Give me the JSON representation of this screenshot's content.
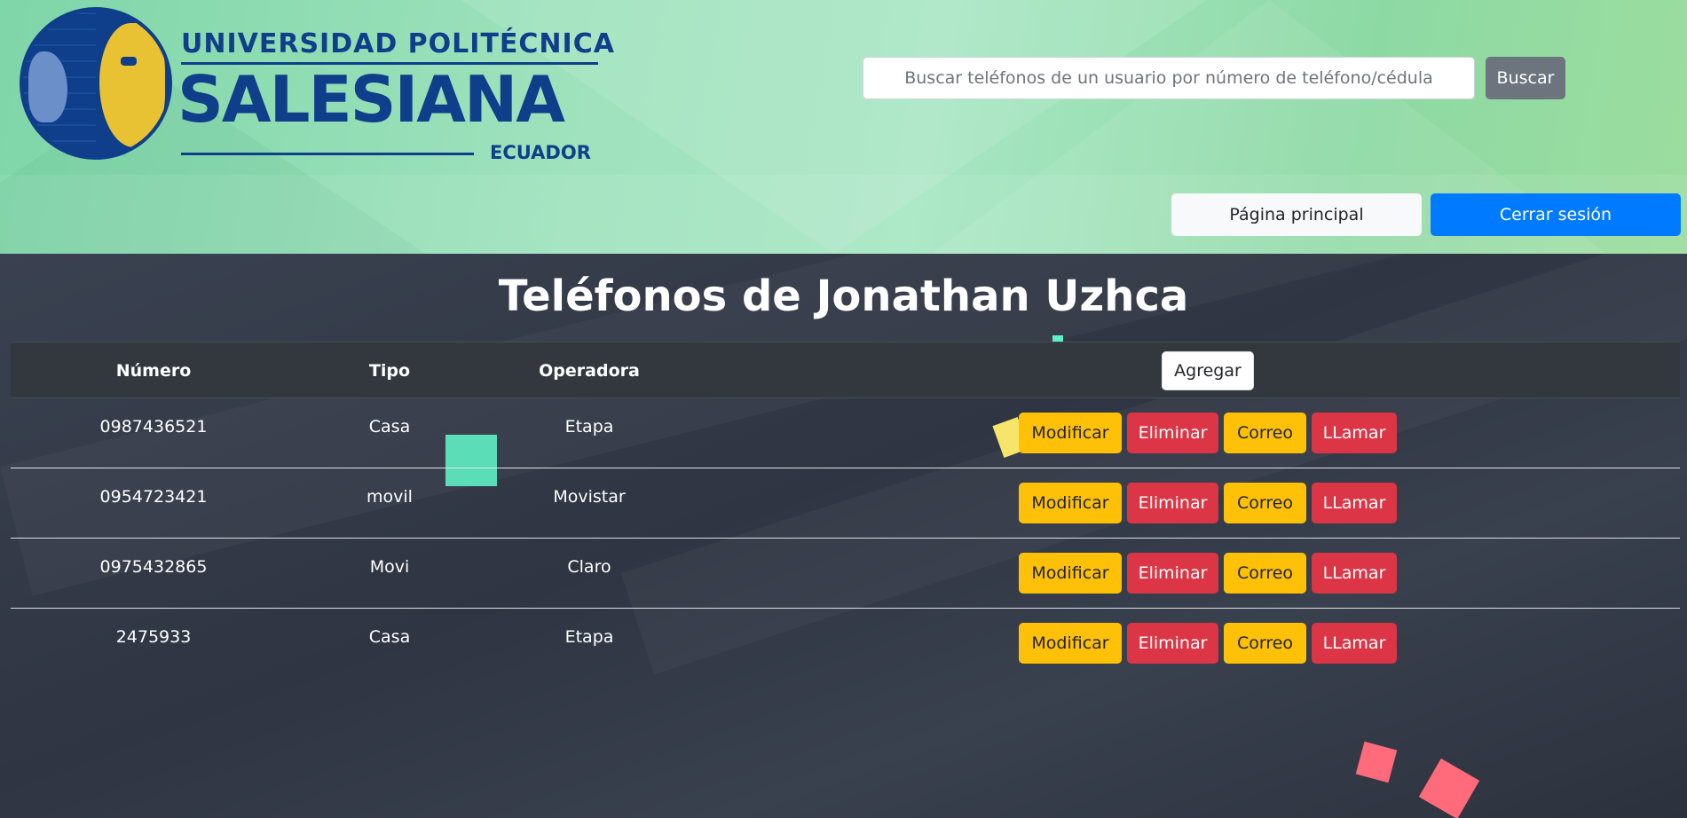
{
  "brand": {
    "line1": "UNIVERSIDAD POLITÉCNICA",
    "line2": "SALESIANA",
    "line3": "ECUADOR"
  },
  "search": {
    "placeholder": "Buscar teléfonos de un usuario por número de teléfono/cédula",
    "button_label": "Buscar"
  },
  "nav": {
    "home_label": "Página principal",
    "logout_label": "Cerrar sesión"
  },
  "page": {
    "title": "Teléfonos de Jonathan Uzhca"
  },
  "table": {
    "headers": {
      "numero": "Número",
      "tipo": "Tipo",
      "operadora": "Operadora"
    },
    "add_label": "Agregar",
    "rows": [
      {
        "numero": "0987436521",
        "tipo": "Casa",
        "operadora": "Etapa"
      },
      {
        "numero": "0954723421",
        "tipo": "movil",
        "operadora": "Movistar"
      },
      {
        "numero": "0975432865",
        "tipo": "Movi",
        "operadora": "Claro"
      },
      {
        "numero": "2475933",
        "tipo": "Casa",
        "operadora": "Etapa"
      }
    ],
    "actions": {
      "modify": "Modificar",
      "delete": "Eliminar",
      "mail": "Correo",
      "call": "LLamar"
    }
  },
  "colors": {
    "header_bg": "#9fe2bd",
    "main_bg": "#2f3542",
    "brand_blue": "#0f3e8a",
    "brand_yellow": "#e8c233",
    "primary": "#007bff",
    "secondary": "#6c757d",
    "warning": "#ffc107",
    "danger": "#dc3545"
  }
}
